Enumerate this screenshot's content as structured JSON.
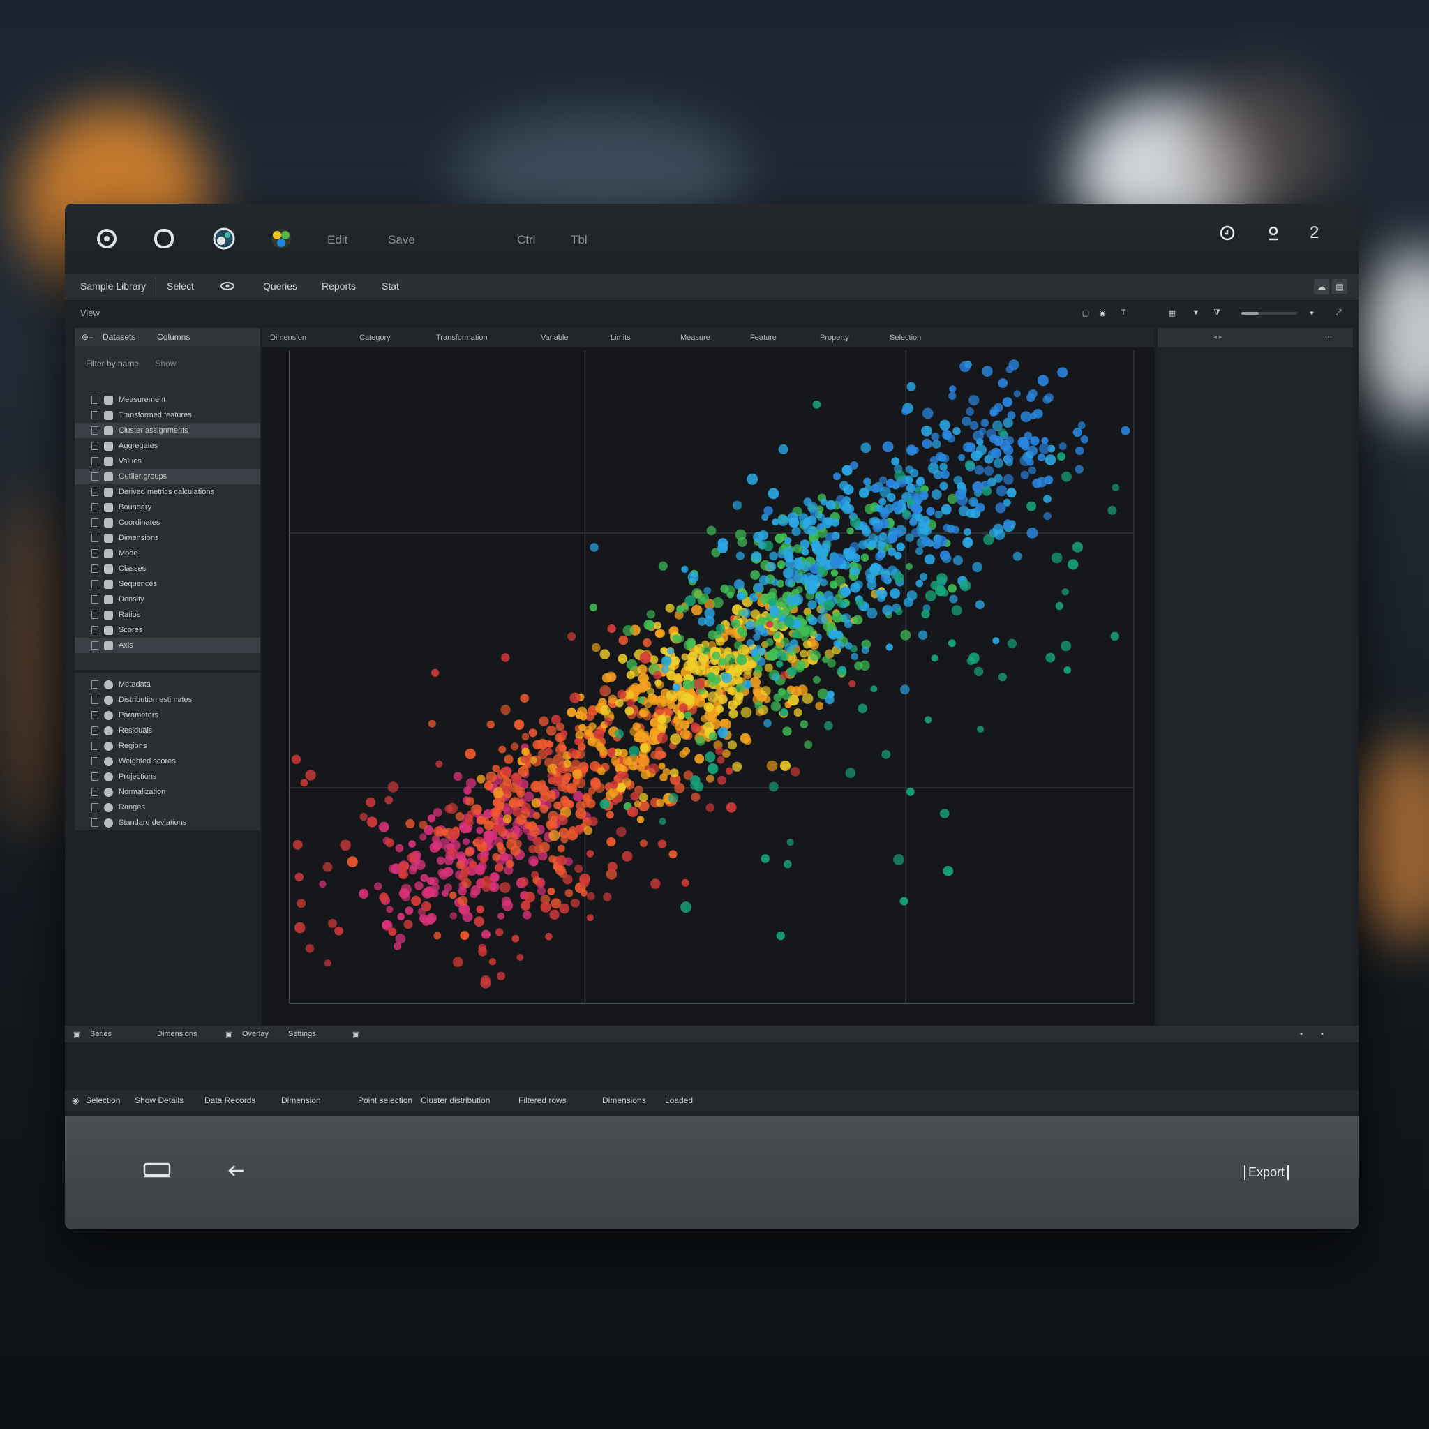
{
  "titlebar": {
    "menu_left": [
      "Edit",
      "Save"
    ],
    "menu_mid": [
      "Ctrl",
      "Tbl"
    ],
    "badge_count": "2",
    "icons": [
      "target-icon",
      "circle-icon",
      "globe-icon",
      "palette-icon"
    ],
    "right_icons": [
      "clock-icon",
      "user-icon"
    ]
  },
  "menubar": {
    "items": [
      "Sample Library",
      "Select",
      "Queries",
      "Reports",
      "Stat"
    ],
    "right_buttons": [
      "cloud-icon",
      "layers-icon"
    ]
  },
  "subbar": {
    "label": "View"
  },
  "sidebar": {
    "header": [
      "Datasets",
      "Columns"
    ],
    "filter": "Filter by name",
    "filter_hint": "Show",
    "group1": [
      "Measurement",
      "Transformed features",
      "Cluster assignments",
      "Aggregates",
      "Values",
      "Outlier groups",
      "Derived metrics calculations",
      "Boundary",
      "Coordinates",
      "Dimensions",
      "Mode",
      "Classes",
      "Sequences",
      "Density",
      "Ratios",
      "Scores",
      "Axis"
    ],
    "group2": [
      "Metadata",
      "Distribution estimates",
      "Parameters",
      "Residuals",
      "Regions",
      "Weighted scores",
      "Projections",
      "Normalization",
      "Ranges",
      "Standard deviations"
    ]
  },
  "columns": [
    "Dimension",
    "Category",
    "Transformation",
    "Variable",
    "Limits",
    "Measure",
    "Feature",
    "Property",
    "Selection"
  ],
  "statusbar": {
    "items": [
      "Series",
      "Dimensions",
      "Overlay",
      "Settings"
    ]
  },
  "infobar": {
    "items": [
      "Selection",
      "Show Details",
      "Data Records",
      "Dimension",
      "Point selection",
      "Cluster distribution",
      "Filtered rows",
      "Dimensions",
      "Loaded"
    ]
  },
  "footer": {
    "label": "Export"
  },
  "chart_data": {
    "type": "scatter",
    "title": "",
    "xlabel": "",
    "ylabel": "",
    "xlim": [
      0,
      1
    ],
    "ylim": [
      0,
      1
    ],
    "grid": true,
    "color_scale": [
      "#e0306a",
      "#e8433a",
      "#f07a22",
      "#f2c225",
      "#52b848",
      "#22a7df",
      "#1f86db"
    ],
    "clusters": [
      {
        "name": "",
        "cx": 0.22,
        "cy": 0.23,
        "spread": 0.06,
        "count": 180,
        "color": "#d9327a"
      },
      {
        "name": "",
        "cx": 0.33,
        "cy": 0.33,
        "spread": 0.08,
        "count": 260,
        "color": "#ef5a30"
      },
      {
        "name": "",
        "cx": 0.45,
        "cy": 0.45,
        "spread": 0.07,
        "count": 260,
        "color": "#f5a21f"
      },
      {
        "name": "",
        "cx": 0.52,
        "cy": 0.52,
        "spread": 0.06,
        "count": 180,
        "color": "#f0cf2a"
      },
      {
        "name": "",
        "cx": 0.58,
        "cy": 0.6,
        "spread": 0.08,
        "count": 220,
        "color": "#3fbd55"
      },
      {
        "name": "",
        "cx": 0.68,
        "cy": 0.7,
        "spread": 0.09,
        "count": 320,
        "color": "#2aa8e6"
      },
      {
        "name": "",
        "cx": 0.8,
        "cy": 0.82,
        "spread": 0.08,
        "count": 140,
        "color": "#2b86e0"
      },
      {
        "name": "",
        "cx": 0.25,
        "cy": 0.25,
        "spread": 0.15,
        "count": 160,
        "color": "#d43a3a"
      },
      {
        "name": "",
        "cx": 0.7,
        "cy": 0.55,
        "spread": 0.18,
        "count": 90,
        "color": "#18a67a"
      }
    ]
  }
}
